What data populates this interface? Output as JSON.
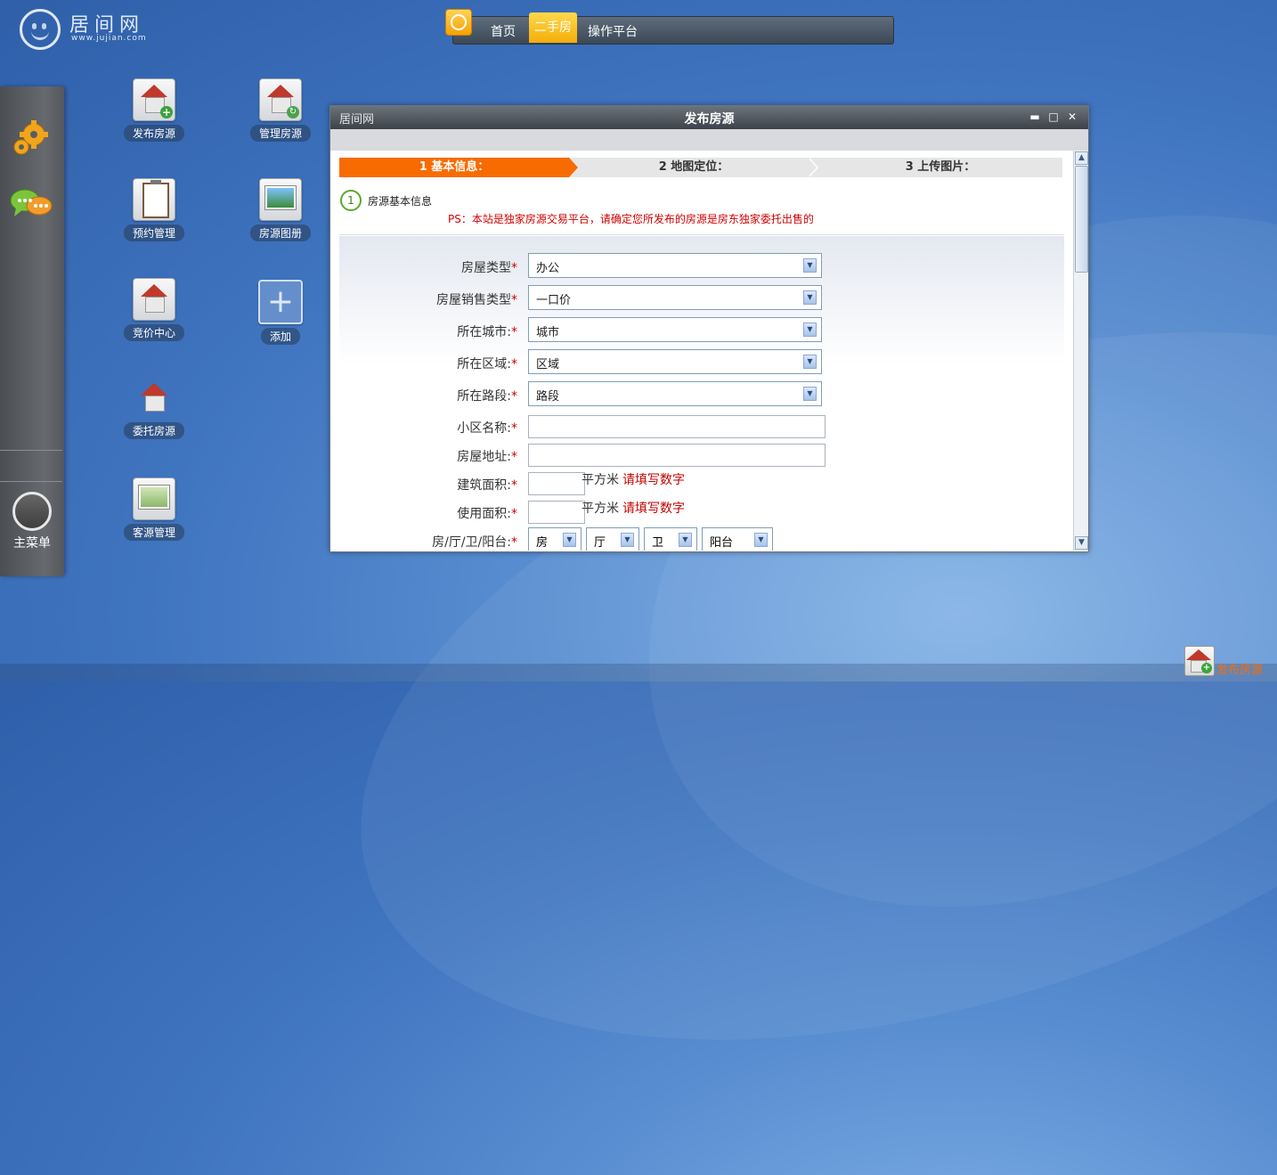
{
  "logo": {
    "name": "居间网",
    "url": "www.jujian.com"
  },
  "topnav": {
    "tabs": [
      "首页",
      "二手房",
      "操作平台"
    ],
    "active": "二手房"
  },
  "dock": {
    "main_menu_label": "主菜单"
  },
  "desktop_icons": [
    {
      "label": "发布房源"
    },
    {
      "label": "管理房源"
    },
    {
      "label": "预约管理"
    },
    {
      "label": "房源图册"
    },
    {
      "label": "竞价中心"
    },
    {
      "label": "添加"
    },
    {
      "label": "委托房源"
    },
    {
      "label": "客源管理"
    }
  ],
  "modal": {
    "brand": "居间网",
    "title": "发布房源",
    "steps": [
      "1 基本信息：",
      "2 地图定位：",
      "3 上传图片："
    ],
    "section_number": "1",
    "section_title": "房源基本信息",
    "notice": "PS：本站是独家房源交易平台，请确定您所发布的房源是房东独家委托出售的",
    "fields": {
      "house_type": {
        "label": "房屋类型",
        "value": "办公"
      },
      "sale_type": {
        "label": "房屋销售类型",
        "value": "一口价"
      },
      "city": {
        "label": "所在城市:",
        "value": "城市"
      },
      "district": {
        "label": "所在区域:",
        "value": "区域"
      },
      "road": {
        "label": "所在路段:",
        "value": "路段"
      },
      "community": {
        "label": "小区名称:",
        "value": ""
      },
      "address": {
        "label": "房屋地址:",
        "value": ""
      },
      "build_area": {
        "label": "建筑面积:",
        "unit": "平方米",
        "hint": "请填写数字"
      },
      "use_area": {
        "label": "使用面积:",
        "unit": "平方米",
        "hint": "请填写数字"
      },
      "layout": {
        "label": "房/厅/卫/阳台:",
        "room": "房",
        "hall": "厅",
        "bath": "卫",
        "balcony": "阳台"
      }
    },
    "required_mark": "*"
  },
  "taskbar": {
    "item_label": "发布房源"
  },
  "colors": {
    "accent": "#f76b00",
    "required": "#d00000",
    "nav_active": "#f4ad0a"
  }
}
